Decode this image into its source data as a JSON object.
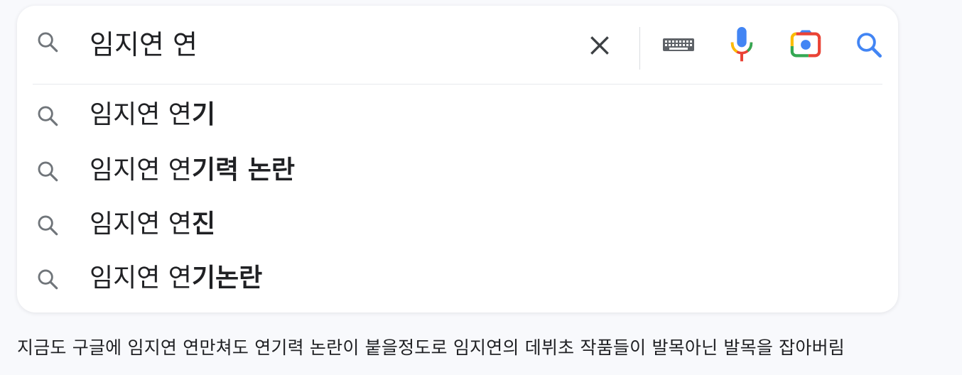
{
  "search": {
    "query": "임지연 연",
    "icons": [
      "search-icon",
      "clear-icon",
      "keyboard-icon",
      "mic-icon",
      "camera-lens-icon",
      "search-submit-icon"
    ]
  },
  "suggestions": [
    {
      "prefix": "임지연 연",
      "completion": "기"
    },
    {
      "prefix": "임지연 연",
      "completion": "기력 논란"
    },
    {
      "prefix": "임지연 연",
      "completion": "진"
    },
    {
      "prefix": "임지연 연",
      "completion": "기논란"
    }
  ],
  "caption": "지금도 구글에 임지연 연만쳐도 연기력 논란이 붙을정도로 임지연의 데뷔초 작품들이 발목아닌 발목을 잡아버림",
  "colors": {
    "mic_blue": "#4285f4",
    "mic_red": "#ea4335",
    "mic_yellow": "#fbbc04",
    "mic_green": "#34a853",
    "search_blue": "#4285f4",
    "icon_gray": "#70757a"
  }
}
